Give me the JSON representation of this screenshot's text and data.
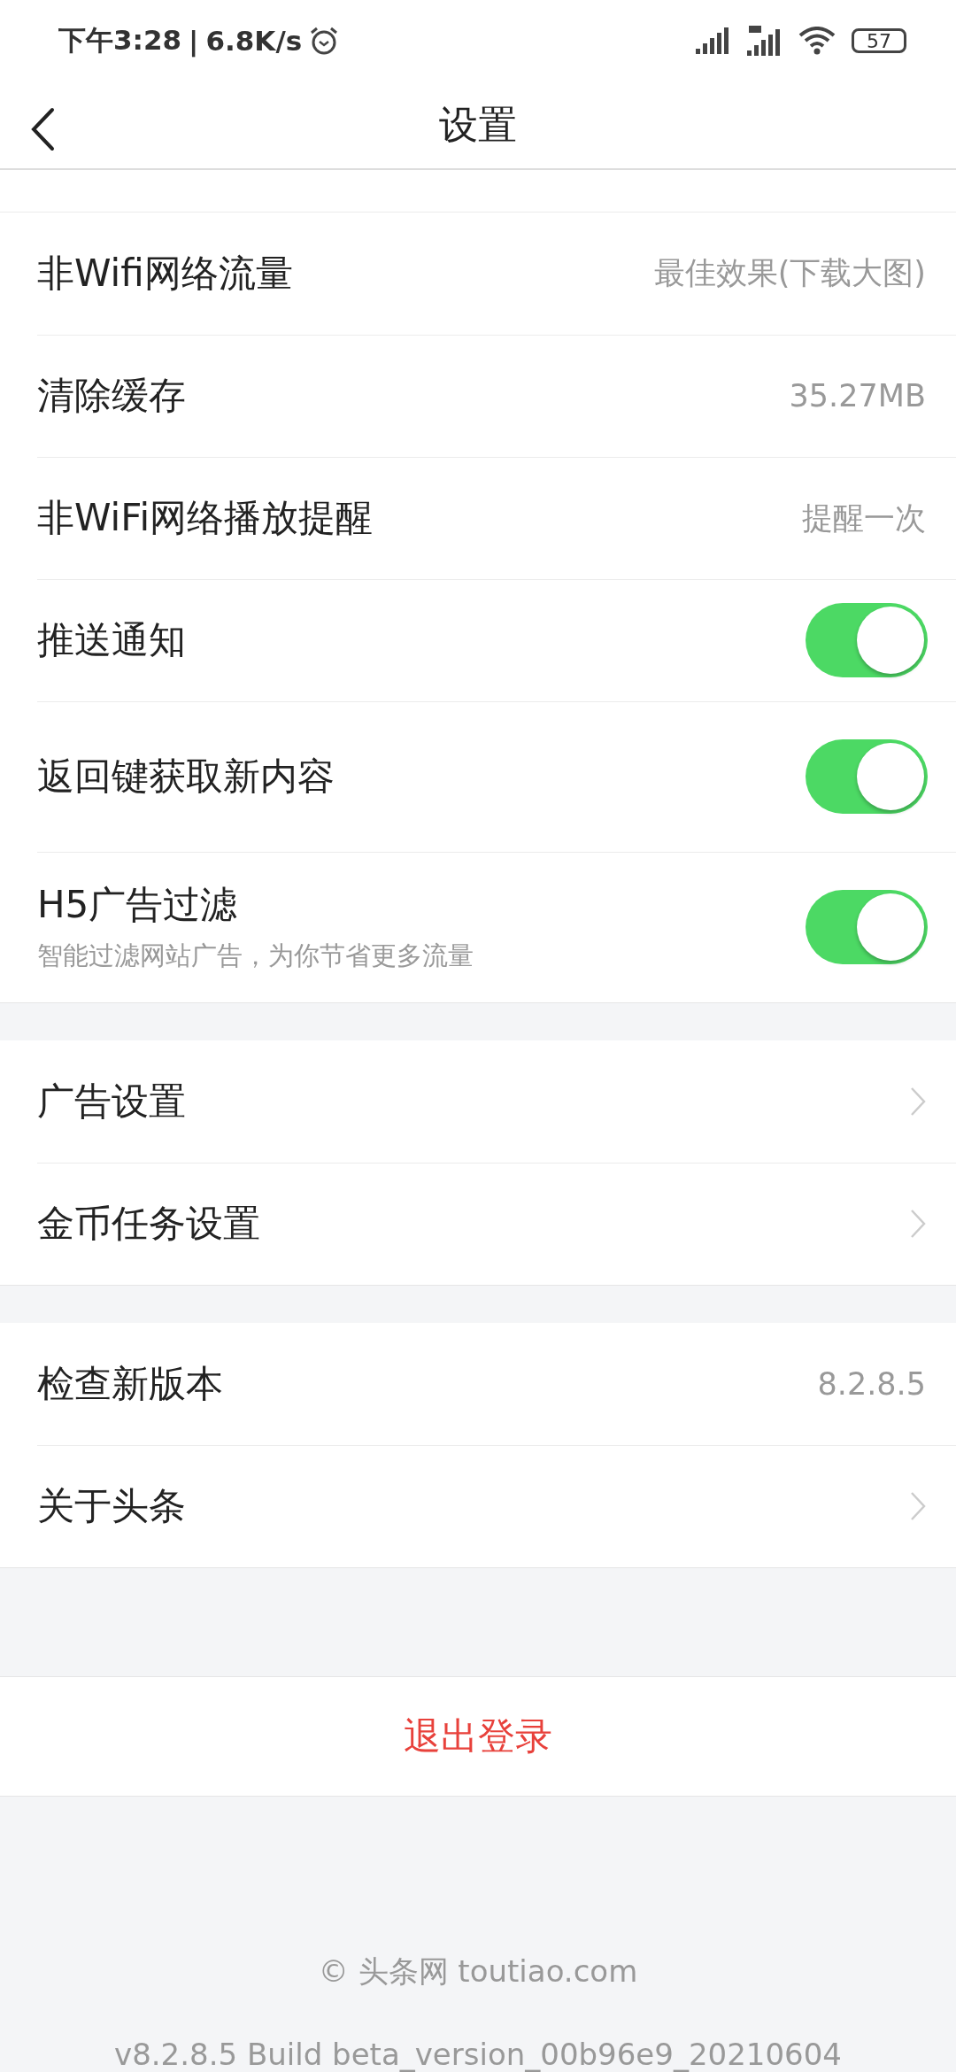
{
  "status_bar": {
    "time": "下午3:28",
    "separator": "|",
    "speed": "6.8K/s",
    "battery": "57"
  },
  "nav": {
    "title": "设置"
  },
  "groups": [
    {
      "items": [
        {
          "kind": "value",
          "label": "非Wifi网络流量",
          "value": "最佳效果(下载大图)"
        },
        {
          "kind": "value",
          "label": "清除缓存",
          "value": "35.27MB"
        },
        {
          "kind": "value",
          "label": "非WiFi网络播放提醒",
          "value": "提醒一次"
        },
        {
          "kind": "toggle",
          "label": "推送通知",
          "on": true
        },
        {
          "kind": "toggle",
          "label": "返回键获取新内容",
          "on": true
        },
        {
          "kind": "toggle",
          "label": "H5广告过滤",
          "subtitle": "智能过滤网站广告，为你节省更多流量",
          "on": true
        }
      ]
    },
    {
      "items": [
        {
          "kind": "link",
          "label": "广告设置"
        },
        {
          "kind": "link",
          "label": "金币任务设置"
        }
      ]
    },
    {
      "items": [
        {
          "kind": "value",
          "label": "检查新版本",
          "value": "8.2.8.5"
        },
        {
          "kind": "link",
          "label": "关于头条"
        }
      ]
    }
  ],
  "logout": "退出登录",
  "footer": {
    "copyright": "© 头条网 toutiao.com",
    "build": "v8.2.8.5 Build beta_version_00b96e9_20210604"
  }
}
